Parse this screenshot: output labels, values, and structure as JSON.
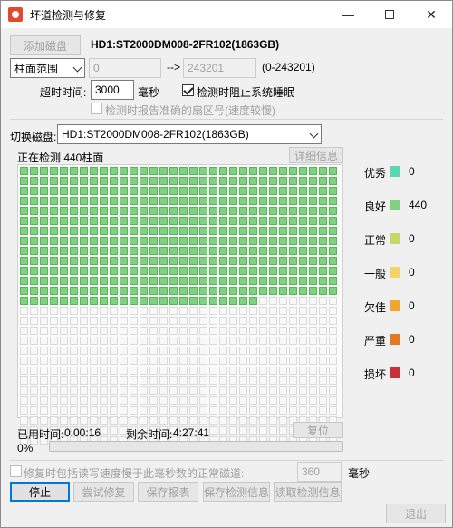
{
  "window": {
    "title": "坏道检测与修复"
  },
  "top": {
    "add_disk_label": "添加磁盘",
    "disk_name": "HD1:ST2000DM008-2FR102(1863GB)",
    "range_mode": "柱面范围",
    "range_start": "0",
    "range_arrow": "-->",
    "range_end": "243201",
    "range_hint": "(0-243201)"
  },
  "timeout": {
    "label": "超时时间:",
    "value": "3000",
    "unit": "毫秒",
    "block_sleep_label": "检测时阻止系统睡眠",
    "block_sleep_checked": true,
    "report_sector_label": "检测时报告准确的扇区号(速度较慢)",
    "report_sector_checked": false
  },
  "switch_disk": {
    "label": "切换磁盘:",
    "value": "HD1:ST2000DM008-2FR102(1863GB)"
  },
  "scan": {
    "status_text": "正在检测 440柱面",
    "detail_button": "详细信息",
    "good_blocks": 440,
    "total_blocks": 896
  },
  "legend": [
    {
      "label": "优秀",
      "count": "0",
      "color": "#5dd6b3"
    },
    {
      "label": "良好",
      "count": "440",
      "color": "#80d181"
    },
    {
      "label": "正常",
      "count": "0",
      "color": "#c6d86a"
    },
    {
      "label": "一般",
      "count": "0",
      "color": "#f5d36a"
    },
    {
      "label": "欠佳",
      "count": "0",
      "color": "#f2a531"
    },
    {
      "label": "严重",
      "count": "0",
      "color": "#e07b24"
    },
    {
      "label": "损坏",
      "count": "0",
      "color": "#c8303a"
    }
  ],
  "timing": {
    "elapsed_label": "已用时间:",
    "elapsed_value": "0:00:16",
    "remaining_label": "剩余时间:",
    "remaining_value": "4:27:41",
    "reset_button": "复位",
    "percent": "0%",
    "progress_fraction": 0
  },
  "repair": {
    "label": "修复时包括读写速度慢于此毫秒数的正常磁道:",
    "checked": false,
    "value": "360",
    "unit": "毫秒"
  },
  "buttons": {
    "stop": "停止",
    "try_repair": "尝试修复",
    "save_report": "保存报表",
    "save_info": "保存检测信息",
    "read_info": "读取检测信息",
    "exit": "退出"
  }
}
